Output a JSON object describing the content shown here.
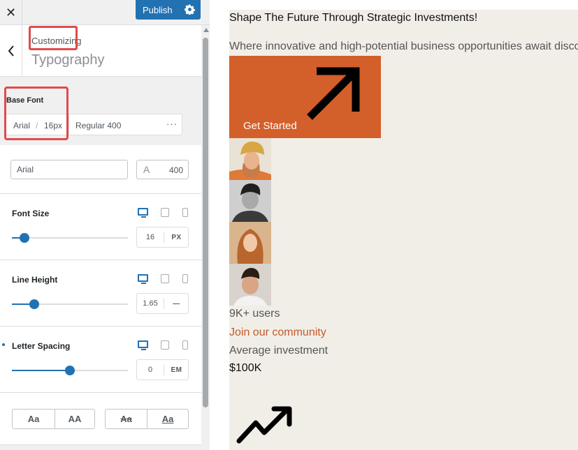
{
  "topbar": {
    "close_icon": "close-icon",
    "publish_label": "Publish",
    "settings_icon": "gear-icon"
  },
  "section": {
    "back_icon": "chevron-left-icon",
    "customizing": "Customizing",
    "title": "Typography"
  },
  "base_font": {
    "label": "Base Font",
    "family": "Arial",
    "separator": "/",
    "size": "16px",
    "weight": "Regular 400",
    "more": "···"
  },
  "font_family": {
    "value": "Arial",
    "weight_glyph": "A",
    "weight_value": "400"
  },
  "font_size": {
    "label": "Font Size",
    "value": "16",
    "unit": "PX",
    "slider_fraction": 0.11
  },
  "line_height": {
    "label": "Line Height",
    "value": "1.65",
    "unit": "—",
    "slider_fraction": 0.19
  },
  "letter_spacing": {
    "label": "Letter Spacing",
    "value": "0",
    "unit": "EM",
    "slider_fraction": 0.5
  },
  "text_transform": [
    "Aa",
    "AA"
  ],
  "text_decoration": [
    "Aa",
    "Aa"
  ],
  "preview": {
    "heading": "Shape The Future Through Strategic Investments!",
    "subheading": "Where innovative and high-potential business opportunities await disco",
    "cta_label": "Get Started",
    "cta_icon": "arrow-up-right-icon",
    "users": "9K+ users",
    "join": "Join our community",
    "avg_label": "Average investment",
    "avg_value": "$100K",
    "trend_icon": "trending-up-icon",
    "accent_color": "#d35f2a",
    "background_color": "#f1eee8"
  }
}
